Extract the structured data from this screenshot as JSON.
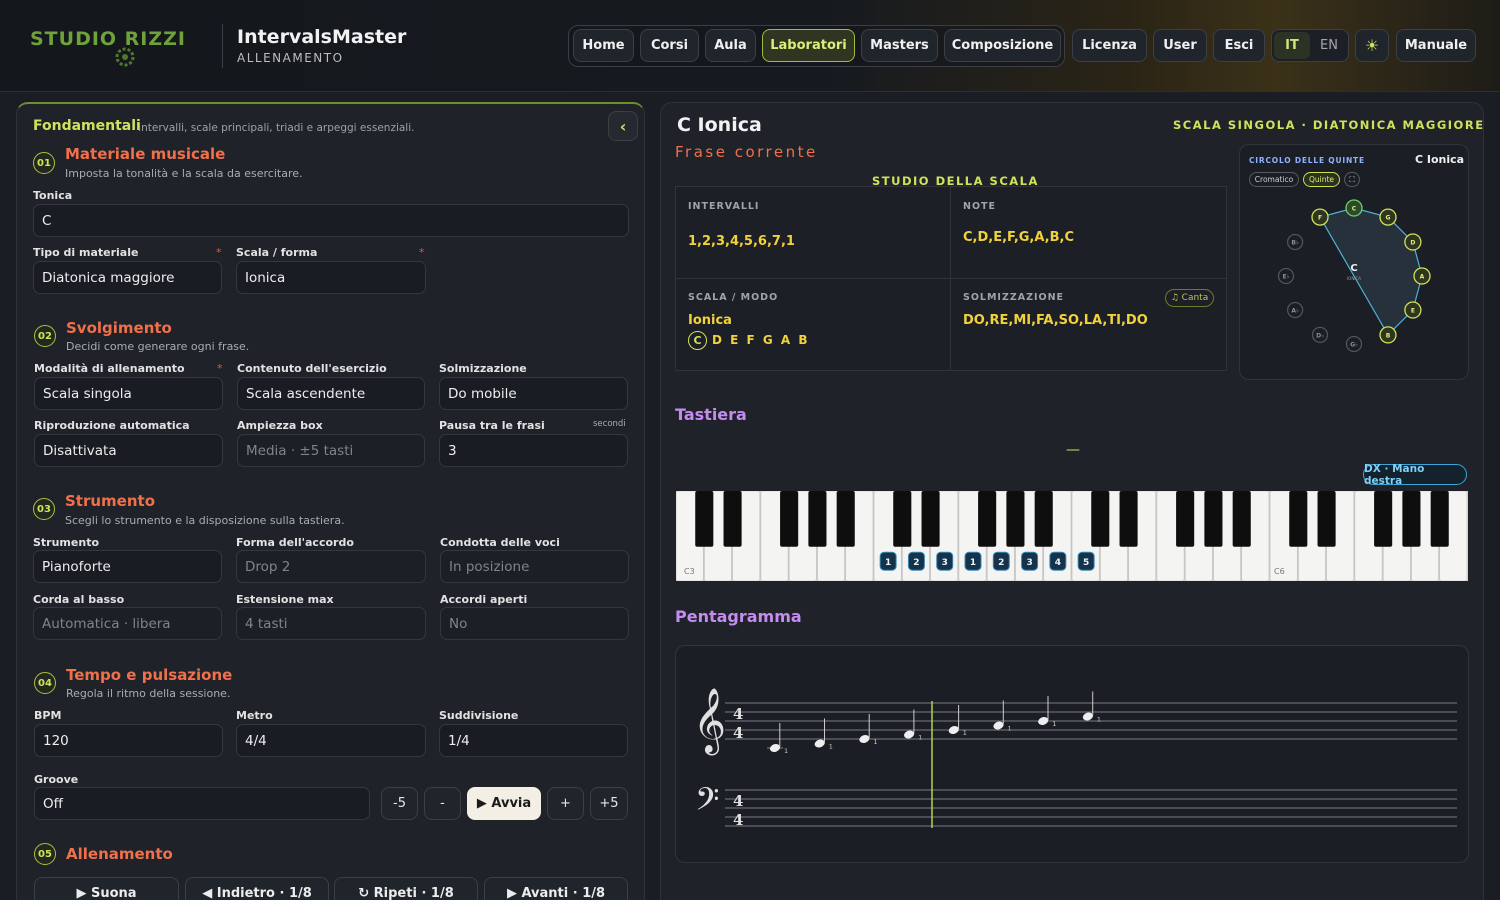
{
  "header": {
    "logo_text": "STUDIO RIZZI",
    "app_title": "IntervalsMaster",
    "app_subtitle": "ALLENAMENTO",
    "nav": [
      "Home",
      "Corsi",
      "Aula",
      "Laboratori",
      "Masters",
      "Composizione",
      "Licenza",
      "User",
      "Esci"
    ],
    "active_nav": "Laboratori",
    "lang_it": "IT",
    "lang_en": "EN",
    "manual_label": "Manuale"
  },
  "left": {
    "title": "Fondamentali",
    "desc": "Intervalli, scale principali, triadi e arpeggi essenziali.",
    "collapse": "‹",
    "s1": {
      "num": "01",
      "title": "Materiale musicale",
      "desc": "Imposta la tonalità e la scala da esercitare.",
      "tonica_label": "Tonica",
      "tonica": "C",
      "tipo_label": "Tipo di materiale",
      "tipo": "Diatonica maggiore",
      "scala_label": "Scala / forma",
      "scala": "Ionica",
      "req": "*"
    },
    "s2": {
      "num": "02",
      "title": "Svolgimento",
      "desc": "Decidi come generare ogni frase.",
      "mod_label": "Modalità di allenamento",
      "mod": "Scala singola",
      "cont_label": "Contenuto dell'esercizio",
      "cont": "Scala ascendente",
      "solm_label": "Solmizzazione",
      "solm": "Do mobile",
      "ripr_label": "Riproduzione automatica",
      "ripr": "Disattivata",
      "amp_label": "Ampiezza box",
      "amp": "Media · ±5 tasti",
      "pausa_label": "Pausa tra le frasi",
      "pausa_unit": "secondi",
      "pausa": "3"
    },
    "s3": {
      "num": "03",
      "title": "Strumento",
      "desc": "Scegli lo strumento e la disposizione sulla tastiera.",
      "str_label": "Strumento",
      "str": "Pianoforte",
      "forma_label": "Forma dell'accordo",
      "forma": "Drop 2",
      "cond_label": "Condotta delle voci",
      "cond": "In posizione",
      "corda_label": "Corda al basso",
      "corda": "Automatica · libera",
      "est_label": "Estensione max",
      "est": "4 tasti",
      "aperti_label": "Accordi aperti",
      "aperti": "No"
    },
    "s4": {
      "num": "04",
      "title": "Tempo e pulsazione",
      "desc": "Regola il ritmo della sessione.",
      "bpm_label": "BPM",
      "bpm": "120",
      "metro_label": "Metro",
      "metro": "4/4",
      "sudd_label": "Suddivisione",
      "sudd": "1/4",
      "groove_label": "Groove",
      "groove": "Off",
      "minus5": "-5",
      "minus": "-",
      "start": "▶ Avvia",
      "plus": "+",
      "plus5": "+5"
    },
    "s5": {
      "num": "05",
      "title": "Allenamento",
      "suona": "▶ Suona",
      "indietro": "◀ Indietro · 1/8",
      "ripeti": "↻ Ripeti · 1/8",
      "avanti": "▶ Avanti · 1/8"
    }
  },
  "right": {
    "title": "C Ionica",
    "badge": "SCALA SINGOLA · DIATONICA MAGGIORE",
    "phrase_label": "Frase corrente",
    "study_title": "STUDIO DELLA SCALA",
    "intervalli_label": "INTERVALLI",
    "intervalli": "1,2,3,4,5,6,7,1",
    "note_label": "NOTE",
    "note": "C,D,E,F,G,A,B,C",
    "scala_label": "SCALA / MODO",
    "scala": "Ionica",
    "scala_root": "C",
    "scala_notes": "D E F G A B",
    "solm_label": "SOLMIZZAZIONE",
    "solm": "DO,RE,MI,FA,SO,LA,TI,DO",
    "canta": "♫ Canta",
    "circle": {
      "title": "CIRCOLO DELLE QUINTE",
      "key": "C Ionica",
      "cromatico": "Cromatico",
      "quinte": "Quinte",
      "expand": "⛶",
      "center": "C",
      "center_sub": "IONICA",
      "nodes": [
        "C",
        "G",
        "D",
        "A",
        "E",
        "B",
        "G♭",
        "D♭",
        "A♭",
        "E♭",
        "B♭",
        "F"
      ],
      "active": [
        "F",
        "C",
        "G",
        "D",
        "A",
        "E",
        "B"
      ]
    },
    "tastiera_label": "Tastiera",
    "dash": "—",
    "hand": "DX · Mano destra",
    "kb": {
      "c3": "C3",
      "c6": "C6",
      "fingers": [
        "1",
        "2",
        "3",
        "1",
        "2",
        "3",
        "4",
        "5"
      ]
    },
    "penta_label": "Pentagramma",
    "time_sig": [
      "4",
      "4"
    ],
    "fingering": [
      "1",
      "1",
      "1",
      "1",
      "1",
      "1",
      "1",
      "1"
    ]
  },
  "colors": {
    "accent": "#cfe35a",
    "orange": "#f0704a",
    "purple": "#c58cf0",
    "yellow": "#f2d23c",
    "blue": "#3aa6d8"
  }
}
